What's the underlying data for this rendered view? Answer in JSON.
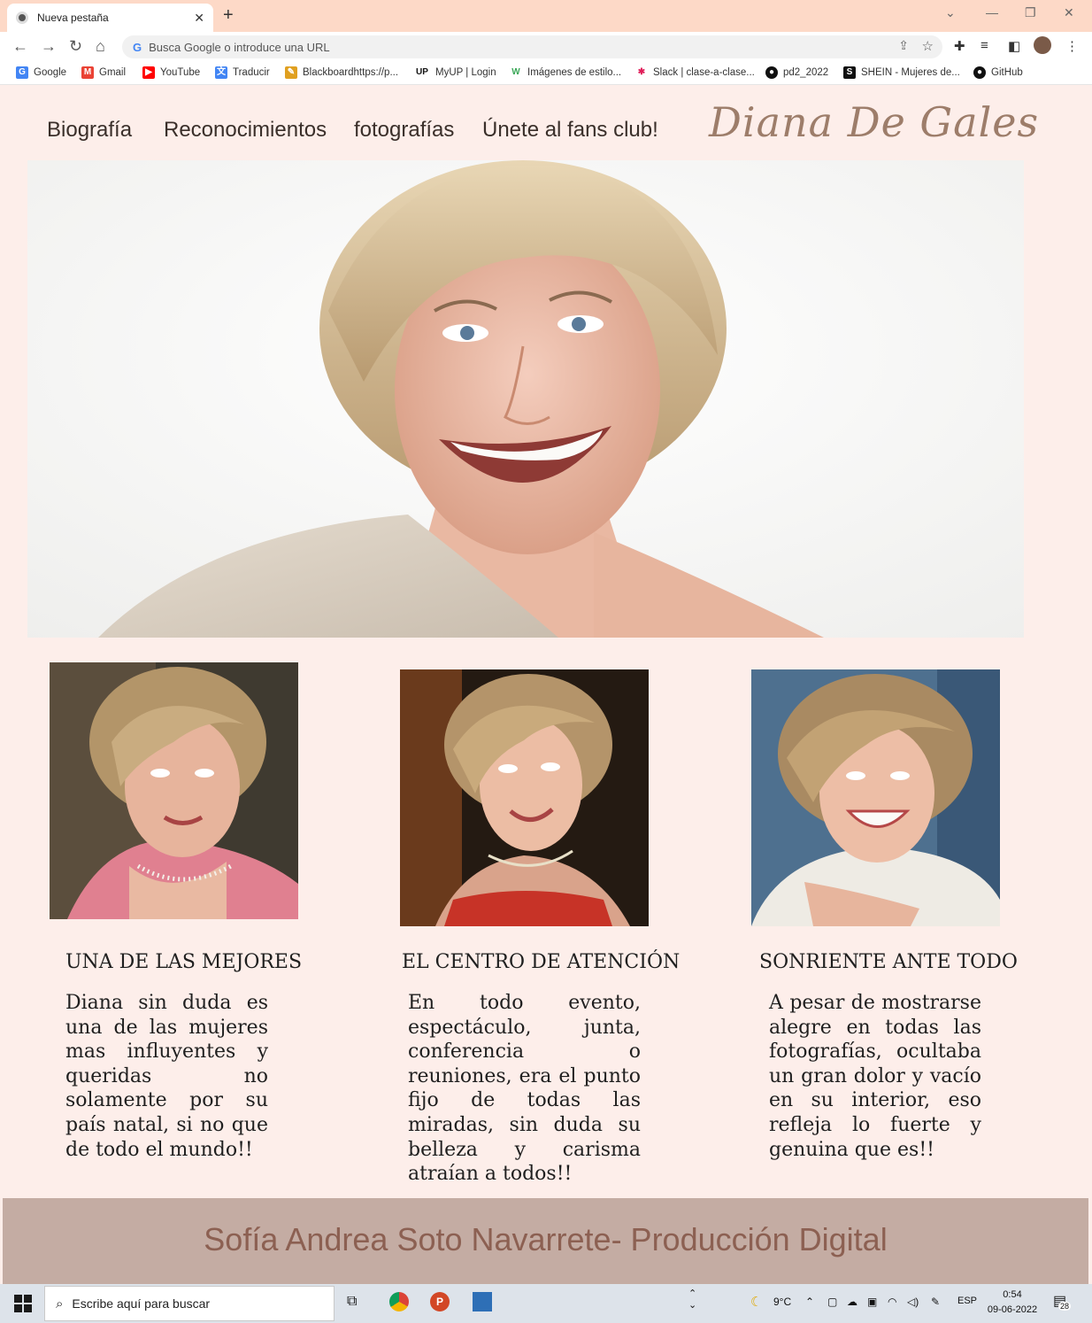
{
  "browser": {
    "tab_title": "Nueva pestaña",
    "omnibox_placeholder": "Busca Google o introduce una URL",
    "bookmarks": [
      {
        "label": "Google",
        "color": "#4285f4"
      },
      {
        "label": "Gmail",
        "color": "#ea4335"
      },
      {
        "label": "YouTube",
        "color": "#ff0000"
      },
      {
        "label": "Traducir",
        "color": "#4285f4"
      },
      {
        "label": "Blackboardhttps://p...",
        "color": "#e0a020"
      },
      {
        "label": "MyUP | Login",
        "color": "#111111"
      },
      {
        "label": "Imágenes de estilo...",
        "color": "#3aa757"
      },
      {
        "label": "Slack | clase-a-clase...",
        "color": "#611f69"
      },
      {
        "label": "pd2_2022",
        "color": "#111111"
      },
      {
        "label": "SHEIN - Mujeres de...",
        "color": "#111111"
      },
      {
        "label": "GitHub",
        "color": "#111111"
      }
    ]
  },
  "site": {
    "nav": [
      "Biografía",
      "Reconocimientos",
      "fotografías",
      "Únete al fans club!"
    ],
    "title": "Diana De Gales",
    "cards": [
      {
        "title": "UNA DE LAS MEJORES",
        "text": "Diana sin duda es una de las mujeres mas influyentes y queridas no solamente por su país natal, si no que de todo el mundo!!"
      },
      {
        "title": "EL CENTRO DE ATENCIÓN",
        "text": "En todo evento, espectáculo, junta, conferencia o reuniones, era el punto fijo de todas las miradas, sin duda su belleza y carisma atraían a todos!!"
      },
      {
        "title": "SONRIENTE ANTE TODO",
        "text": "A pesar de mostrarse alegre en todas las fotografías, ocultaba un gran dolor y vacío en su interior, eso refleja lo fuerte y genuina que es!!"
      }
    ],
    "footer": "Sofía Andrea Soto Navarrete- Producción Digital"
  },
  "taskbar": {
    "search_placeholder": "Escribe aquí para buscar",
    "weather": "9°C",
    "language": "ESP",
    "time": "0:54",
    "date": "09-06-2022",
    "notifications": "28"
  }
}
